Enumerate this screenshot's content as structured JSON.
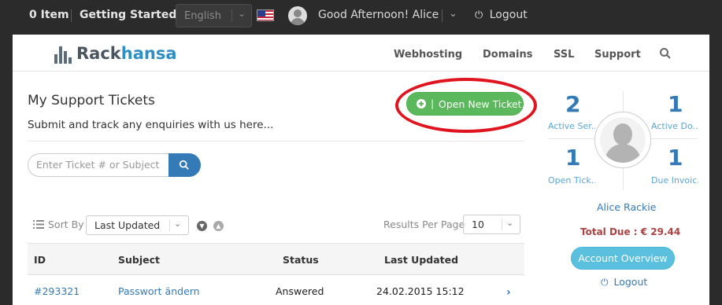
{
  "topbar": {
    "cart": "0 Item",
    "getting_started": "Getting Started",
    "language": "English",
    "flag": "us-flag-icon",
    "greeting": "Good Afternoon! Alice",
    "logout": "Logout"
  },
  "header": {
    "logo_part1": "Rack",
    "logo_part2": "hansa",
    "nav": [
      "Webhosting",
      "Domains",
      "SSL",
      "Support"
    ]
  },
  "main": {
    "title": "My Support Tickets",
    "subtitle": "Submit and track any enquiries with us here...",
    "new_ticket_separator": "|",
    "new_ticket_label": "Open New Ticket",
    "search_placeholder": "Enter Ticket # or Subject",
    "sort_by_label": "Sort By",
    "sort_value": "Last Updated",
    "results_per_page_label": "Results Per Page",
    "results_per_page_value": "10",
    "table": {
      "columns": [
        "ID",
        "Subject",
        "Status",
        "Last Updated"
      ],
      "rows": [
        {
          "id": "#293321",
          "subject": "Passwort ändern",
          "status": "Answered",
          "last_updated": "24.02.2015 15:12"
        }
      ]
    }
  },
  "sidebar": {
    "stats": [
      {
        "value": "2",
        "label": "Active Ser..."
      },
      {
        "value": "1",
        "label": "Active Do..."
      },
      {
        "value": "1",
        "label": "Open Tick..."
      },
      {
        "value": "1",
        "label": "Due Invoic..."
      }
    ],
    "client_name": "Alice Rackie",
    "total_due": "Total Due : € 29.44",
    "account_overview": "Account Overview",
    "logout": "Logout"
  },
  "colors": {
    "topbar_bg": "#2b2b2b",
    "primary": "#337ab7",
    "success": "#5cb85c",
    "info": "#5bc0de",
    "danger": "#a94442",
    "highlight_ring": "#e0141e"
  }
}
